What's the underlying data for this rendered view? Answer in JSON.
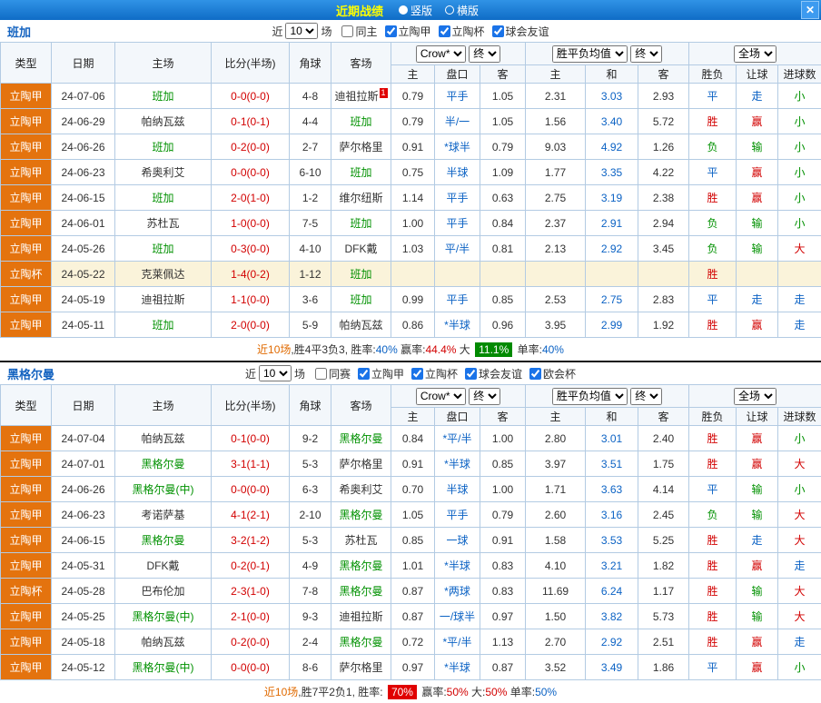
{
  "titlebar": {
    "title": "近期战绩",
    "vertical": "竖版",
    "horizontal": "横版",
    "close": "✕"
  },
  "filters_labels": {
    "near": "近",
    "games": "场"
  },
  "table_header": {
    "type": "类型",
    "date": "日期",
    "home": "主场",
    "score": "比分(半场)",
    "corner": "角球",
    "away": "客场",
    "h": "主",
    "handicap": "盘口",
    "a": "客",
    "draw": "和",
    "result": "胜负",
    "let": "让球",
    "goals": "进球数",
    "company": "Crow*",
    "final": "终",
    "avg": "胜平负均值",
    "fulltime": "全场"
  },
  "colors": {
    "accent_blue": "#0b62c4",
    "win_red": "#d20000",
    "lose_green": "#019101",
    "type_orange": "#e4730e"
  },
  "sections": [
    {
      "team": "班加",
      "count": "10",
      "checks": [
        {
          "label": "同主",
          "checked": false
        },
        {
          "label": "立陶甲",
          "checked": true
        },
        {
          "label": "立陶杯",
          "checked": true
        },
        {
          "label": "球会友谊",
          "checked": true
        }
      ],
      "rows": [
        {
          "type": "立陶甲",
          "date": "24-07-06",
          "home": "班加",
          "home_green": true,
          "score": "0-0(0-0)",
          "corner": "4-8",
          "away": "迪祖拉斯",
          "away_badge": "1",
          "odds": [
            "0.79",
            "平手",
            "1.05"
          ],
          "europe": [
            "2.31",
            "3.03",
            "2.93"
          ],
          "result": "平",
          "let": "走",
          "goal": "小"
        },
        {
          "type": "立陶甲",
          "date": "24-06-29",
          "home": "帕纳瓦兹",
          "score": "0-1(0-1)",
          "corner": "4-4",
          "away": "班加",
          "away_green": true,
          "odds": [
            "0.79",
            "半/一",
            "1.05"
          ],
          "europe": [
            "1.56",
            "3.40",
            "5.72"
          ],
          "result": "胜",
          "let": "赢",
          "goal": "小"
        },
        {
          "type": "立陶甲",
          "date": "24-06-26",
          "home": "班加",
          "home_green": true,
          "score": "0-2(0-0)",
          "corner": "2-7",
          "away": "萨尔格里",
          "odds": [
            "0.91",
            "*球半",
            "0.79"
          ],
          "europe": [
            "9.03",
            "4.92",
            "1.26"
          ],
          "result": "负",
          "let": "输",
          "goal": "小"
        },
        {
          "type": "立陶甲",
          "date": "24-06-23",
          "home": "希奥利艾",
          "score": "0-0(0-0)",
          "corner": "6-10",
          "away": "班加",
          "away_green": true,
          "odds": [
            "0.75",
            "半球",
            "1.09"
          ],
          "europe": [
            "1.77",
            "3.35",
            "4.22"
          ],
          "result": "平",
          "let": "赢",
          "goal": "小"
        },
        {
          "type": "立陶甲",
          "date": "24-06-15",
          "home": "班加",
          "home_green": true,
          "score": "2-0(1-0)",
          "corner": "1-2",
          "away": "维尔纽斯",
          "odds": [
            "1.14",
            "平手",
            "0.63"
          ],
          "europe": [
            "2.75",
            "3.19",
            "2.38"
          ],
          "result": "胜",
          "let": "赢",
          "goal": "小"
        },
        {
          "type": "立陶甲",
          "date": "24-06-01",
          "home": "苏杜瓦",
          "score": "1-0(0-0)",
          "corner": "7-5",
          "away": "班加",
          "away_green": true,
          "odds": [
            "1.00",
            "平手",
            "0.84"
          ],
          "europe": [
            "2.37",
            "2.91",
            "2.94"
          ],
          "result": "负",
          "let": "输",
          "goal": "小"
        },
        {
          "type": "立陶甲",
          "date": "24-05-26",
          "home": "班加",
          "home_green": true,
          "score": "0-3(0-0)",
          "corner": "4-10",
          "away": "DFK戴",
          "odds": [
            "1.03",
            "平/半",
            "0.81"
          ],
          "europe": [
            "2.13",
            "2.92",
            "3.45"
          ],
          "result": "负",
          "let": "输",
          "goal": "大"
        },
        {
          "type": "立陶杯",
          "date": "24-05-22",
          "home": "克莱佩达",
          "score": "1-4(0-2)",
          "corner": "1-12",
          "away": "班加",
          "away_green": true,
          "odds": [
            "",
            "",
            ""
          ],
          "europe": [
            "",
            "",
            ""
          ],
          "result": "胜",
          "let": "",
          "goal": "",
          "hl": true
        },
        {
          "type": "立陶甲",
          "date": "24-05-19",
          "home": "迪祖拉斯",
          "score": "1-1(0-0)",
          "corner": "3-6",
          "away": "班加",
          "away_green": true,
          "odds": [
            "0.99",
            "平手",
            "0.85"
          ],
          "europe": [
            "2.53",
            "2.75",
            "2.83"
          ],
          "result": "平",
          "let": "走",
          "goal": "走"
        },
        {
          "type": "立陶甲",
          "date": "24-05-11",
          "home": "班加",
          "home_green": true,
          "score": "2-0(0-0)",
          "corner": "5-9",
          "away": "帕纳瓦兹",
          "odds": [
            "0.86",
            "*半球",
            "0.96"
          ],
          "europe": [
            "3.95",
            "2.99",
            "1.92"
          ],
          "result": "胜",
          "let": "赢",
          "goal": "走"
        }
      ],
      "summary": [
        {
          "text": "近10场",
          "color": "#e06a00"
        },
        {
          "text": ",胜4平3负3, 胜率:",
          "color": "#333333"
        },
        {
          "text": "40%",
          "color": "#0b62c4"
        },
        {
          "text": " 赢率:",
          "color": "#333333"
        },
        {
          "text": "44.4%",
          "color": "#d20000"
        },
        {
          "text": " 大 ",
          "color": "#333333"
        },
        {
          "text": "11.1%",
          "color": "#ffffff",
          "bg": "#018a01"
        },
        {
          "text": " 单率:",
          "color": "#333333"
        },
        {
          "text": "40%",
          "color": "#0b62c4"
        }
      ]
    },
    {
      "team": "黑格尔曼",
      "count": "10",
      "checks": [
        {
          "label": "同赛",
          "checked": false
        },
        {
          "label": "立陶甲",
          "checked": true
        },
        {
          "label": "立陶杯",
          "checked": true
        },
        {
          "label": "球会友谊",
          "checked": true
        },
        {
          "label": "欧会杯",
          "checked": true
        }
      ],
      "rows": [
        {
          "type": "立陶甲",
          "date": "24-07-04",
          "home": "帕纳瓦兹",
          "score": "0-1(0-0)",
          "corner": "9-2",
          "away": "黑格尔曼",
          "away_green": true,
          "odds": [
            "0.84",
            "*平/半",
            "1.00"
          ],
          "europe": [
            "2.80",
            "3.01",
            "2.40"
          ],
          "result": "胜",
          "let": "赢",
          "goal": "小"
        },
        {
          "type": "立陶甲",
          "date": "24-07-01",
          "home": "黑格尔曼",
          "home_green": true,
          "score": "3-1(1-1)",
          "corner": "5-3",
          "away": "萨尔格里",
          "odds": [
            "0.91",
            "*半球",
            "0.85"
          ],
          "europe": [
            "3.97",
            "3.51",
            "1.75"
          ],
          "result": "胜",
          "let": "赢",
          "goal": "大"
        },
        {
          "type": "立陶甲",
          "date": "24-06-26",
          "home": "黑格尔曼(中)",
          "home_green": true,
          "score": "0-0(0-0)",
          "corner": "6-3",
          "away": "希奥利艾",
          "odds": [
            "0.70",
            "半球",
            "1.00"
          ],
          "europe": [
            "1.71",
            "3.63",
            "4.14"
          ],
          "result": "平",
          "let": "输",
          "goal": "小"
        },
        {
          "type": "立陶甲",
          "date": "24-06-23",
          "home": "考诺萨基",
          "score": "4-1(2-1)",
          "corner": "2-10",
          "away": "黑格尔曼",
          "away_green": true,
          "odds": [
            "1.05",
            "平手",
            "0.79"
          ],
          "europe": [
            "2.60",
            "3.16",
            "2.45"
          ],
          "result": "负",
          "let": "输",
          "goal": "大"
        },
        {
          "type": "立陶甲",
          "date": "24-06-15",
          "home": "黑格尔曼",
          "home_green": true,
          "score": "3-2(1-2)",
          "corner": "5-3",
          "away": "苏杜瓦",
          "odds": [
            "0.85",
            "一球",
            "0.91"
          ],
          "europe": [
            "1.58",
            "3.53",
            "5.25"
          ],
          "result": "胜",
          "let": "走",
          "goal": "大"
        },
        {
          "type": "立陶甲",
          "date": "24-05-31",
          "home": "DFK戴",
          "score": "0-2(0-1)",
          "corner": "4-9",
          "away": "黑格尔曼",
          "away_green": true,
          "odds": [
            "1.01",
            "*半球",
            "0.83"
          ],
          "europe": [
            "4.10",
            "3.21",
            "1.82"
          ],
          "result": "胜",
          "let": "赢",
          "goal": "走"
        },
        {
          "type": "立陶杯",
          "date": "24-05-28",
          "home": "巴布伦加",
          "score": "2-3(1-0)",
          "corner": "7-8",
          "away": "黑格尔曼",
          "away_green": true,
          "odds": [
            "0.87",
            "*两球",
            "0.83"
          ],
          "europe": [
            "11.69",
            "6.24",
            "1.17"
          ],
          "result": "胜",
          "let": "输",
          "goal": "大"
        },
        {
          "type": "立陶甲",
          "date": "24-05-25",
          "home": "黑格尔曼(中)",
          "home_green": true,
          "score": "2-1(0-0)",
          "corner": "9-3",
          "away": "迪祖拉斯",
          "odds": [
            "0.87",
            "一/球半",
            "0.97"
          ],
          "europe": [
            "1.50",
            "3.82",
            "5.73"
          ],
          "result": "胜",
          "let": "输",
          "goal": "大"
        },
        {
          "type": "立陶甲",
          "date": "24-05-18",
          "home": "帕纳瓦兹",
          "score": "0-2(0-0)",
          "corner": "2-4",
          "away": "黑格尔曼",
          "away_green": true,
          "odds": [
            "0.72",
            "*平/半",
            "1.13"
          ],
          "europe": [
            "2.70",
            "2.92",
            "2.51"
          ],
          "result": "胜",
          "let": "赢",
          "goal": "走"
        },
        {
          "type": "立陶甲",
          "date": "24-05-12",
          "home": "黑格尔曼(中)",
          "home_green": true,
          "score": "0-0(0-0)",
          "corner": "8-6",
          "away": "萨尔格里",
          "odds": [
            "0.97",
            "*半球",
            "0.87"
          ],
          "europe": [
            "3.52",
            "3.49",
            "1.86"
          ],
          "result": "平",
          "let": "赢",
          "goal": "小"
        }
      ],
      "summary": [
        {
          "text": "近10场",
          "color": "#e06a00"
        },
        {
          "text": ",胜7平2负1, 胜率: ",
          "color": "#333333"
        },
        {
          "text": "70%",
          "color": "#ffffff",
          "bg": "#e00000"
        },
        {
          "text": " 赢率:",
          "color": "#333333"
        },
        {
          "text": "50%",
          "color": "#d20000"
        },
        {
          "text": " 大:",
          "color": "#333333"
        },
        {
          "text": "50%",
          "color": "#d20000"
        },
        {
          "text": " 单率:",
          "color": "#333333"
        },
        {
          "text": "50%",
          "color": "#0b62c4"
        }
      ]
    }
  ]
}
